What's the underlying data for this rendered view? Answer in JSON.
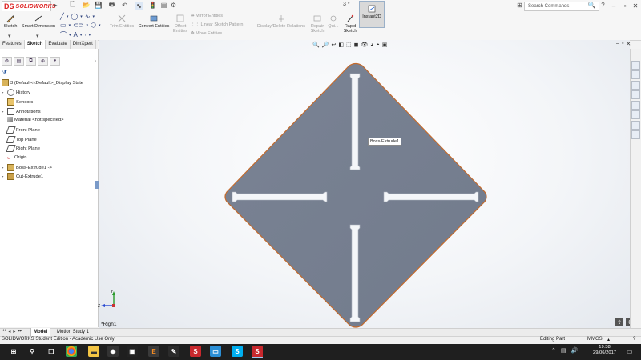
{
  "app": {
    "logo_prefix": "DS",
    "logo_text": "SOLIDWORKS",
    "doc_title": "3 *",
    "search_placeholder": "Search Commands"
  },
  "command_manager": {
    "sketch_label": "Sketch",
    "smart_dimension_label": "Smart Dimension",
    "trim_entities_label": "Trim Entities",
    "convert_entities_label": "Convert Entities",
    "offset_entities_label": "Offset Entities",
    "mirror_entities_label": "Mirror Entities",
    "linear_pattern_label": "Linear Sketch Pattern",
    "move_entities_label": "Move Entities",
    "display_delete_relations_label": "Display/Delete Relations",
    "repair_sketch_label": "Repair Sketch",
    "quick_snaps_label": "Qui...",
    "rapid_sketch_label": "Rapid Sketch",
    "instant2d_label": "Instant2D"
  },
  "tabs": [
    "Features",
    "Sketch",
    "Evaluate",
    "DimXpert"
  ],
  "active_tab": "Sketch",
  "feature_tree": {
    "root": "3  (Default<<Default>_Display State",
    "items": [
      {
        "label": "History",
        "icon": "history-icon",
        "expandable": true
      },
      {
        "label": "Sensors",
        "icon": "sensor-icon",
        "expandable": false
      },
      {
        "label": "Annotations",
        "icon": "annotations-icon",
        "expandable": true
      },
      {
        "label": "Material <not specified>",
        "icon": "material-icon",
        "expandable": false
      },
      {
        "label": "Front Plane",
        "icon": "plane-icon",
        "expandable": false
      },
      {
        "label": "Top Plane",
        "icon": "plane-icon",
        "expandable": false
      },
      {
        "label": "Right Plane",
        "icon": "plane-icon",
        "expandable": false
      },
      {
        "label": "Origin",
        "icon": "origin-icon",
        "expandable": false
      },
      {
        "label": "Boss-Extrude1 ->",
        "icon": "boss-extrude-icon",
        "expandable": true
      },
      {
        "label": "Cut-Extrude1",
        "icon": "cut-extrude-icon",
        "expandable": true
      }
    ]
  },
  "viewport": {
    "tooltip": "Boss-Extrude1",
    "view_name": "*Righ1",
    "triad_y": "Y",
    "triad_z": "Z",
    "part_color": "#7d8597",
    "part_edge_color": "#c46a2c"
  },
  "bottom_tabs": [
    "Model",
    "Motion Study 1"
  ],
  "active_bottom_tab": "Model",
  "status": {
    "left": "SOLIDWORKS Student Edition - Academic Use Only",
    "mode": "Editing Part",
    "units": "MMGS"
  },
  "taskbar": {
    "time": "19:38",
    "date": "29/06/2017"
  }
}
